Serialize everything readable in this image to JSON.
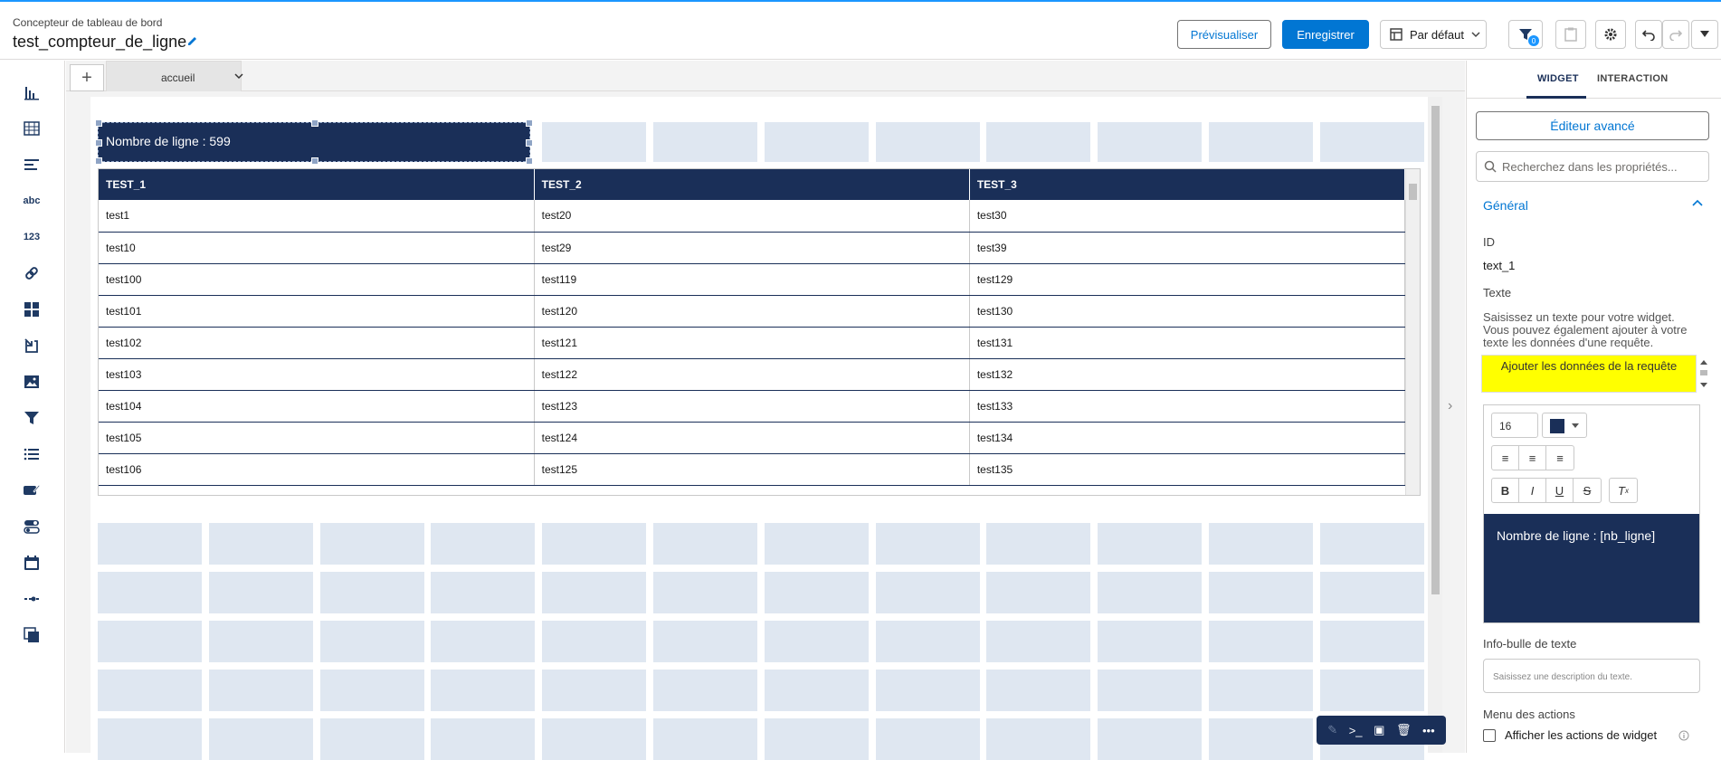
{
  "header": {
    "subtitle": "Concepteur de tableau de bord",
    "title": "test_compteur_de_ligne",
    "preview_label": "Prévisualiser",
    "save_label": "Enregistrer",
    "layout_label": "Par défaut",
    "filter_count": "0"
  },
  "tabs": [
    {
      "label": "accueil"
    }
  ],
  "text_widget": {
    "text": "Nombre de ligne : 599"
  },
  "table": {
    "columns": [
      "TEST_1",
      "TEST_2",
      "TEST_3"
    ],
    "rows": [
      [
        "test1",
        "test20",
        "test30"
      ],
      [
        "test10",
        "test29",
        "test39"
      ],
      [
        "test100",
        "test119",
        "test129"
      ],
      [
        "test101",
        "test120",
        "test130"
      ],
      [
        "test102",
        "test121",
        "test131"
      ],
      [
        "test103",
        "test122",
        "test132"
      ],
      [
        "test104",
        "test123",
        "test133"
      ],
      [
        "test105",
        "test124",
        "test134"
      ],
      [
        "test106",
        "test125",
        "test135"
      ]
    ]
  },
  "right_panel": {
    "tab_widget": "WIDGET",
    "tab_interaction": "INTERACTION",
    "advanced_editor": "Éditeur avancé",
    "search_placeholder": "Recherchez dans les propriétés...",
    "section_general": "Général",
    "id_label": "ID",
    "id_value": "text_1",
    "text_label": "Texte",
    "text_help": "Saisissez un texte pour votre widget. Vous pouvez également ajouter à votre texte les données d'une requête.",
    "add_query_data": "Ajouter les données de la requête",
    "font_size": "16",
    "editor_content": "Nombre de ligne : [nb_ligne]",
    "tooltip_label": "Info-bulle de texte",
    "tooltip_placeholder": "Saisissez une description du texte.",
    "actions_menu_label": "Menu des actions",
    "show_actions_label": "Afficher les actions de widget"
  },
  "colors": {
    "brand": "#0176d3",
    "navy": "#1a2f58",
    "highlight": "#ffff00",
    "grid_cell": "#dfe7f1"
  }
}
